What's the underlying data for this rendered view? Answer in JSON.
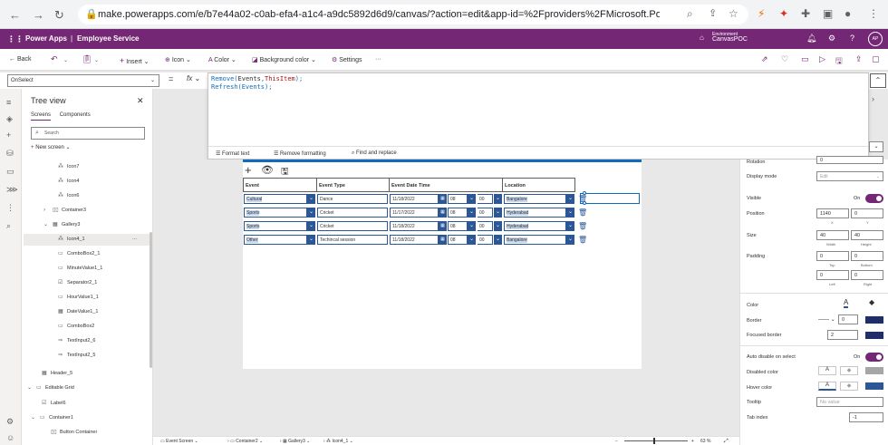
{
  "browser": {
    "url": "make.powerapps.com/e/b7e44a02-c0ab-efa4-a1c4-a9dc5892d6d9/canvas/?action=edit&app-id=%2Fproviders%2FMicrosoft.PowerA..."
  },
  "header": {
    "app": "Power Apps",
    "separator": "|",
    "title": "Employee Service",
    "env_label": "Environment",
    "env_name": "CanvasPOC",
    "avatar": "AP"
  },
  "commands": {
    "back": "Back",
    "insert": "Insert",
    "icon": "Icon",
    "color": "Color",
    "background_color": "Background color",
    "settings": "Settings",
    "more": "···"
  },
  "formula": {
    "property": "OnSelect",
    "eq": "=",
    "fx": "fx",
    "line1_fn": "Remove(",
    "line1_arg1": "Events",
    "line1_sep": ",",
    "line1_arg2": "ThisItem",
    "line1_end": ");",
    "line2": "Refresh(Events);",
    "format_text": "Format text",
    "remove_formatting": "Remove formatting",
    "find_replace": "Find and replace"
  },
  "tree": {
    "title": "Tree view",
    "tab_screens": "Screens",
    "tab_components": "Components",
    "search_placeholder": "Search",
    "new_screen": "New screen",
    "nodes": [
      {
        "label": "Icon7"
      },
      {
        "label": "Icon4"
      },
      {
        "label": "Icon6"
      },
      {
        "label": "Container3"
      },
      {
        "label": "Gallery3"
      },
      {
        "label": "Icon4_1"
      },
      {
        "label": "ComboBox2_1"
      },
      {
        "label": "MinuteValue1_1"
      },
      {
        "label": "Separator2_1"
      },
      {
        "label": "HourValue1_1"
      },
      {
        "label": "DateValue1_1"
      },
      {
        "label": "ComboBox2"
      },
      {
        "label": "TextInput2_6"
      },
      {
        "label": "TextInput2_5"
      },
      {
        "label": "Header_5"
      },
      {
        "label": "Editable Grid"
      },
      {
        "label": "Label6"
      },
      {
        "label": "Container1"
      },
      {
        "label": "Button Container"
      }
    ],
    "selected_more": "···"
  },
  "grid": {
    "headers": [
      "Event",
      "Event Type",
      "Event Date Time",
      "Location"
    ],
    "rows": [
      {
        "event": "Cultural",
        "type": "Dance",
        "date": "11/18/2022",
        "hour": "08",
        "minute": "00",
        "location": "Bangalore"
      },
      {
        "event": "Sports",
        "type": "Cricket",
        "date": "11/17/2022",
        "hour": "08",
        "minute": "00",
        "location": "Hyderabad"
      },
      {
        "event": "Sports",
        "type": "Cricket",
        "date": "11/18/2022",
        "hour": "08",
        "minute": "00",
        "location": "Hyderabad"
      },
      {
        "event": "Other",
        "type": "Techincal session",
        "date": "11/18/2022",
        "hour": "08",
        "minute": "00",
        "location": "Bangalore"
      }
    ]
  },
  "status": {
    "screen": "Event Screen",
    "container": "Container2",
    "gallery": "Gallery3",
    "icon": "Icon4_1",
    "zoom": "63",
    "zoom_unit": "%"
  },
  "props": {
    "rotation_label": "Rotation",
    "rotation": "0",
    "display_mode_label": "Display mode",
    "display_mode": "Edit",
    "visible_label": "Visible",
    "visible_state": "On",
    "position_label": "Position",
    "pos_x": "1140",
    "pos_y": "0",
    "x_label": "X",
    "y_label": "Y",
    "size_label": "Size",
    "width": "40",
    "height": "40",
    "width_label": "Width",
    "height_label": "Height",
    "padding_label": "Padding",
    "pad_top": "0",
    "pad_bottom": "0",
    "pad_left": "0",
    "pad_right": "0",
    "top_label": "Top",
    "bottom_label": "Bottom",
    "left_label": "Left",
    "right_label": "Right",
    "color_label": "Color",
    "border_label": "Border",
    "border_width": "0",
    "focused_border_label": "Focused border",
    "focused_border": "2",
    "auto_disable_label": "Auto disable on select",
    "auto_disable_state": "On",
    "disabled_color_label": "Disabled color",
    "hover_color_label": "Hover color",
    "tooltip_label": "Tooltip",
    "tooltip_placeholder": "No value",
    "tab_index_label": "Tab index",
    "tab_index": "-1"
  },
  "colors": {
    "brand": "#742774",
    "accent": "#0f6cbd",
    "grid_border": "#2b5797",
    "border_swatch": "#1f2d6b",
    "focused_swatch": "#1f2d6b",
    "disabled_swatch": "#a6a6a6",
    "hover_swatch": "#2b5797"
  }
}
